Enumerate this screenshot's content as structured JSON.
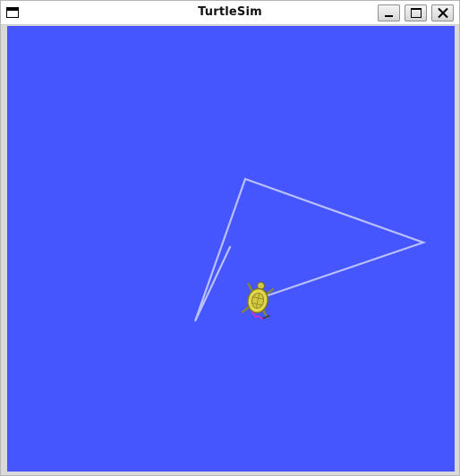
{
  "window": {
    "title": "TurtleSim",
    "controls": [
      "minimize",
      "maximize",
      "close"
    ]
  },
  "canvas": {
    "background_color": "#4556ff",
    "pen_color": "#b9bfff",
    "turtle": {
      "icon": "turtle-icon",
      "shell_color": "#e3d84a",
      "accent_color": "#d22ec8"
    }
  }
}
